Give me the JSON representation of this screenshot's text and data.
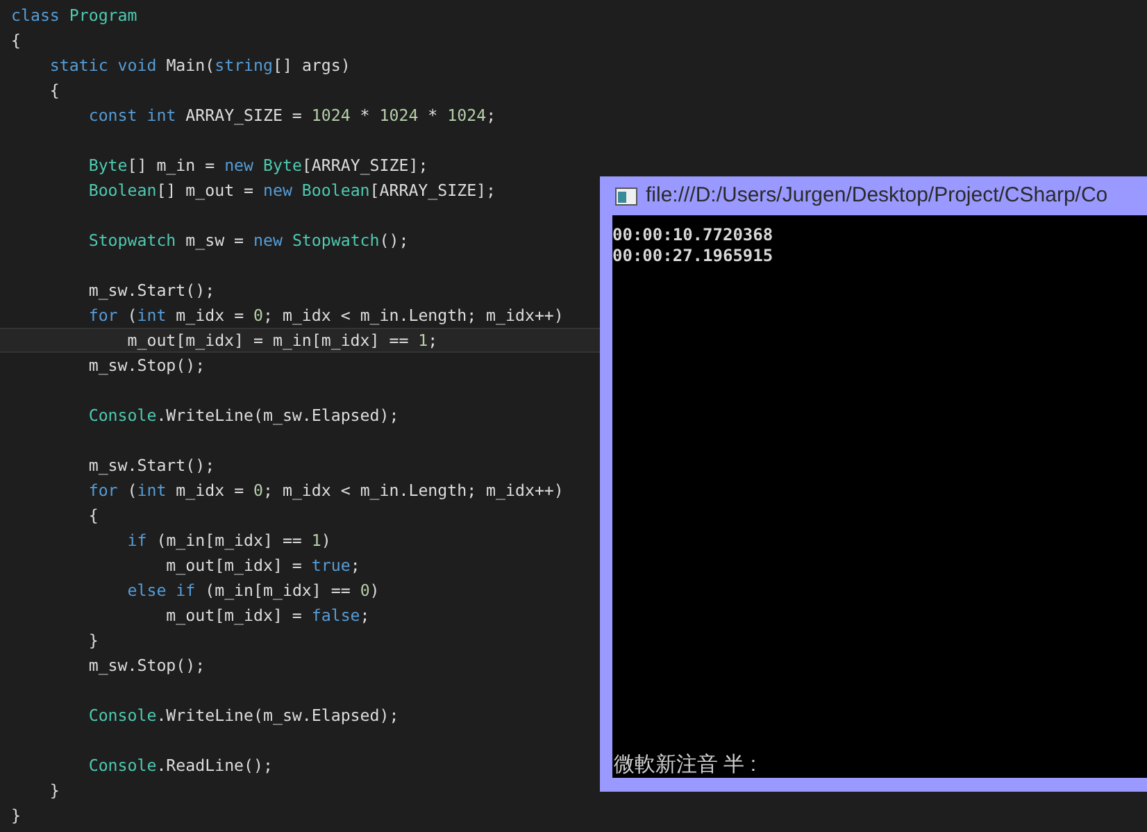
{
  "editor": {
    "lines": [
      {
        "current": false,
        "tokens": [
          {
            "kind": "keyword",
            "text": "class"
          },
          {
            "kind": "type",
            "text": " Program"
          }
        ]
      },
      {
        "current": false,
        "tokens": [
          {
            "kind": "plain",
            "text": "{"
          }
        ]
      },
      {
        "current": false,
        "tokens": [
          {
            "kind": "keyword",
            "text": "    static"
          },
          {
            "kind": "keyword",
            "text": " void"
          },
          {
            "kind": "plain",
            "text": " Main("
          },
          {
            "kind": "keyword",
            "text": "string"
          },
          {
            "kind": "plain",
            "text": "[] args)"
          }
        ]
      },
      {
        "current": false,
        "tokens": [
          {
            "kind": "plain",
            "text": "    {"
          }
        ]
      },
      {
        "current": false,
        "tokens": [
          {
            "kind": "keyword",
            "text": "        const"
          },
          {
            "kind": "keyword",
            "text": " int"
          },
          {
            "kind": "plain",
            "text": " ARRAY_SIZE = "
          },
          {
            "kind": "number",
            "text": "1024"
          },
          {
            "kind": "plain",
            "text": " * "
          },
          {
            "kind": "number",
            "text": "1024"
          },
          {
            "kind": "plain",
            "text": " * "
          },
          {
            "kind": "number",
            "text": "1024"
          },
          {
            "kind": "plain",
            "text": ";"
          }
        ]
      },
      {
        "kind": "blank"
      },
      {
        "current": false,
        "tokens": [
          {
            "kind": "type",
            "text": "        Byte"
          },
          {
            "kind": "plain",
            "text": "[] m_in = "
          },
          {
            "kind": "keyword",
            "text": "new"
          },
          {
            "kind": "type",
            "text": " Byte"
          },
          {
            "kind": "plain",
            "text": "[ARRAY_SIZE];"
          }
        ]
      },
      {
        "current": false,
        "tokens": [
          {
            "kind": "type",
            "text": "        Boolean"
          },
          {
            "kind": "plain",
            "text": "[] m_out = "
          },
          {
            "kind": "keyword",
            "text": "new"
          },
          {
            "kind": "type",
            "text": " Boolean"
          },
          {
            "kind": "plain",
            "text": "[ARRAY_SIZE];"
          }
        ]
      },
      {
        "kind": "blank"
      },
      {
        "current": false,
        "tokens": [
          {
            "kind": "type",
            "text": "        Stopwatch"
          },
          {
            "kind": "plain",
            "text": " m_sw = "
          },
          {
            "kind": "keyword",
            "text": "new"
          },
          {
            "kind": "type",
            "text": " Stopwatch"
          },
          {
            "kind": "plain",
            "text": "();"
          }
        ]
      },
      {
        "kind": "blank"
      },
      {
        "current": false,
        "tokens": [
          {
            "kind": "plain",
            "text": "        m_sw.Start();"
          }
        ]
      },
      {
        "current": false,
        "tokens": [
          {
            "kind": "keyword",
            "text": "        for"
          },
          {
            "kind": "plain",
            "text": " ("
          },
          {
            "kind": "keyword",
            "text": "int"
          },
          {
            "kind": "plain",
            "text": " m_idx = "
          },
          {
            "kind": "number",
            "text": "0"
          },
          {
            "kind": "plain",
            "text": "; m_idx < m_in.Length; m_idx++)"
          }
        ]
      },
      {
        "current": true,
        "tokens": [
          {
            "kind": "plain",
            "text": "            m_out[m_idx] = m_in[m_idx] == "
          },
          {
            "kind": "number",
            "text": "1"
          },
          {
            "kind": "plain",
            "text": ";"
          }
        ]
      },
      {
        "current": false,
        "tokens": [
          {
            "kind": "plain",
            "text": "        m_sw.Stop();"
          }
        ]
      },
      {
        "kind": "blank"
      },
      {
        "current": false,
        "tokens": [
          {
            "kind": "type",
            "text": "        Console"
          },
          {
            "kind": "plain",
            "text": ".WriteLine(m_sw.Elapsed);"
          }
        ]
      },
      {
        "kind": "blank"
      },
      {
        "current": false,
        "tokens": [
          {
            "kind": "plain",
            "text": "        m_sw.Start();"
          }
        ]
      },
      {
        "current": false,
        "tokens": [
          {
            "kind": "keyword",
            "text": "        for"
          },
          {
            "kind": "plain",
            "text": " ("
          },
          {
            "kind": "keyword",
            "text": "int"
          },
          {
            "kind": "plain",
            "text": " m_idx = "
          },
          {
            "kind": "number",
            "text": "0"
          },
          {
            "kind": "plain",
            "text": "; m_idx < m_in.Length; m_idx++)"
          }
        ]
      },
      {
        "current": false,
        "tokens": [
          {
            "kind": "plain",
            "text": "        {"
          }
        ]
      },
      {
        "current": false,
        "tokens": [
          {
            "kind": "keyword",
            "text": "            if"
          },
          {
            "kind": "plain",
            "text": " (m_in[m_idx] == "
          },
          {
            "kind": "number",
            "text": "1"
          },
          {
            "kind": "plain",
            "text": ")"
          }
        ]
      },
      {
        "current": false,
        "tokens": [
          {
            "kind": "plain",
            "text": "                m_out[m_idx] = "
          },
          {
            "kind": "keyword",
            "text": "true"
          },
          {
            "kind": "plain",
            "text": ";"
          }
        ]
      },
      {
        "current": false,
        "tokens": [
          {
            "kind": "keyword",
            "text": "            else"
          },
          {
            "kind": "keyword",
            "text": " if"
          },
          {
            "kind": "plain",
            "text": " (m_in[m_idx] == "
          },
          {
            "kind": "number",
            "text": "0"
          },
          {
            "kind": "plain",
            "text": ")"
          }
        ]
      },
      {
        "current": false,
        "tokens": [
          {
            "kind": "plain",
            "text": "                m_out[m_idx] = "
          },
          {
            "kind": "keyword",
            "text": "false"
          },
          {
            "kind": "plain",
            "text": ";"
          }
        ]
      },
      {
        "current": false,
        "tokens": [
          {
            "kind": "plain",
            "text": "        }"
          }
        ]
      },
      {
        "current": false,
        "tokens": [
          {
            "kind": "plain",
            "text": "        m_sw.Stop();"
          }
        ]
      },
      {
        "kind": "blank"
      },
      {
        "current": false,
        "tokens": [
          {
            "kind": "type",
            "text": "        Console"
          },
          {
            "kind": "plain",
            "text": ".WriteLine(m_sw.Elapsed);"
          }
        ]
      },
      {
        "kind": "blank"
      },
      {
        "current": false,
        "tokens": [
          {
            "kind": "type",
            "text": "        Console"
          },
          {
            "kind": "plain",
            "text": ".ReadLine();"
          }
        ]
      },
      {
        "current": false,
        "tokens": [
          {
            "kind": "plain",
            "text": "    }"
          }
        ]
      },
      {
        "current": false,
        "tokens": [
          {
            "kind": "plain",
            "text": "}"
          }
        ]
      }
    ]
  },
  "console": {
    "title": "file:///D:/Users/Jurgen/Desktop/Project/CSharp/Co",
    "output": [
      "00:00:10.7720368",
      "00:00:27.1965915"
    ],
    "ime_status": "微軟新注音 半 :"
  }
}
